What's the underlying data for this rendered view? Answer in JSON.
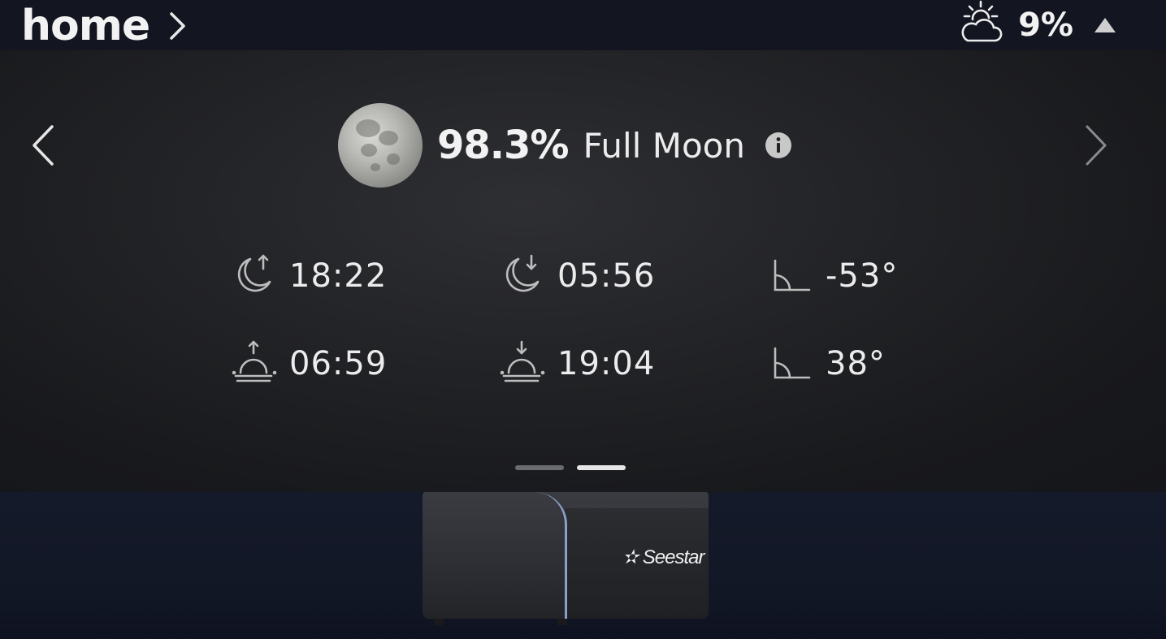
{
  "header": {
    "title": "home",
    "weather_value": "9%"
  },
  "moon": {
    "illumination": "98.3%",
    "phase": "Full Moon"
  },
  "times": {
    "moonrise": "18:22",
    "moonset": "05:56",
    "moon_altitude": "-53°",
    "sunrise": "06:59",
    "sunset": "19:04",
    "sun_altitude": "38°"
  },
  "pager": {
    "count": 2,
    "active": 1
  },
  "device": {
    "brand": "Seestar"
  },
  "colors": {
    "text": "#f2f2f2",
    "icon": "#bdbdbd",
    "dot_inactive": "#6a6b6e",
    "dot_active": "#e6e6e6",
    "device_accent": "#8aa0c8"
  },
  "icons": [
    "chevron-right-icon",
    "partly-cloudy-icon",
    "triangle-up-icon",
    "chevron-left-icon",
    "info-icon",
    "moonrise-icon",
    "moonset-icon",
    "angle-icon",
    "sunrise-icon",
    "sunset-icon"
  ]
}
